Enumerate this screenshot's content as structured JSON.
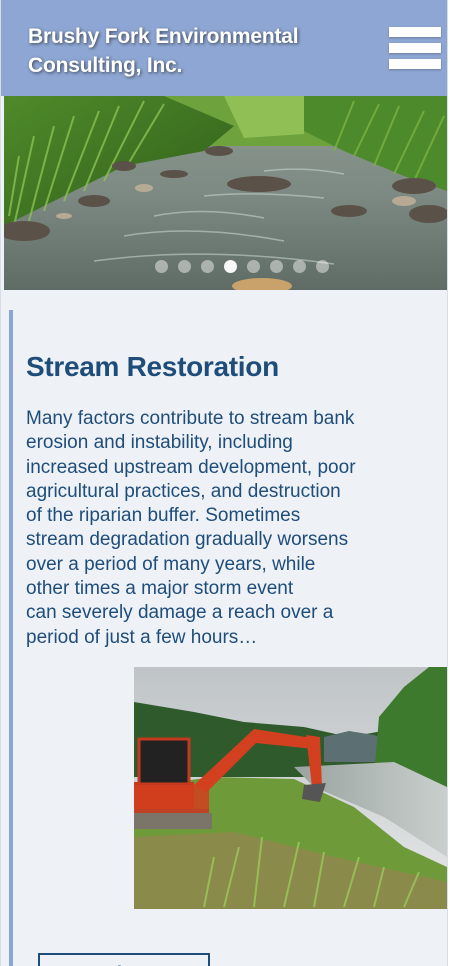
{
  "header": {
    "title": "Brushy Fork Environmental Consulting, Inc.",
    "menu_icon": "hamburger-menu-icon"
  },
  "hero": {
    "slide_count": 8,
    "active_slide": 4
  },
  "section": {
    "title": "Stream Restoration",
    "body": "Many factors contribute to stream bank\nerosion and instability, including\nincreased upstream development, poor\nagricultural practices, and destruction\nof the riparian buffer. Sometimes\nstream degradation gradually worsens\nover a period of many years, while\nother times a major storm event\ncan severely damage a reach over a\nperiod of just a few hours…",
    "read_more_label": "Read More"
  },
  "colors": {
    "header_bg": "#8ea6d3",
    "accent_text": "#1f4d7a",
    "page_bg": "#eef1f6"
  }
}
